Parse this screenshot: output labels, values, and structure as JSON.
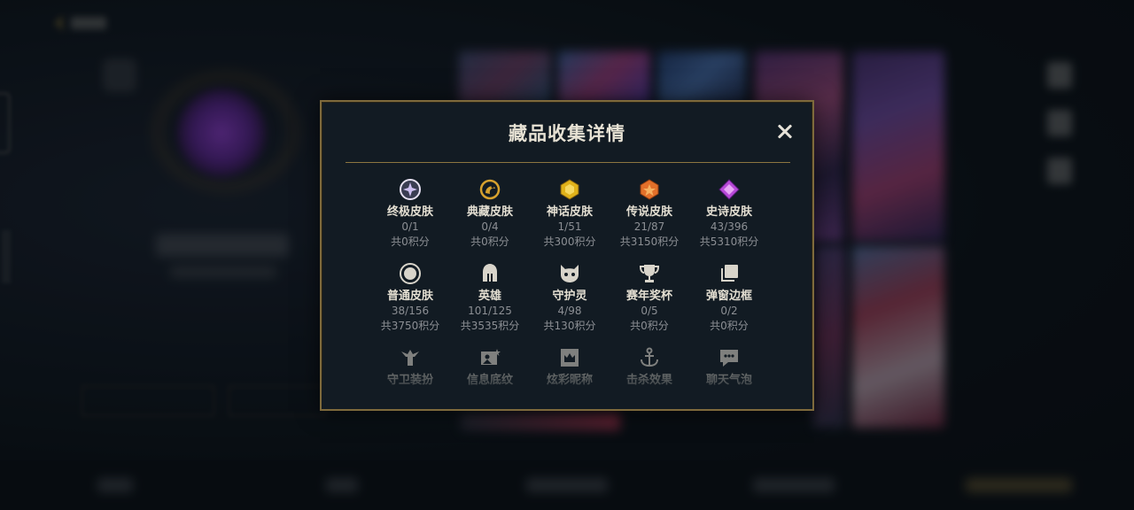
{
  "modal": {
    "title": "藏品收集详情",
    "close_icon": "close-icon",
    "categories": [
      {
        "label": "终极皮肤",
        "count": "0/1",
        "points": "共0积分",
        "icon": "ultimate-skin-icon",
        "color": "#c9b8e8"
      },
      {
        "label": "典藏皮肤",
        "count": "0/4",
        "points": "共0积分",
        "icon": "prestige-skin-icon",
        "color": "#d6a12e"
      },
      {
        "label": "神话皮肤",
        "count": "1/51",
        "points": "共300积分",
        "icon": "mythic-skin-icon",
        "color": "#e0b21a"
      },
      {
        "label": "传说皮肤",
        "count": "21/87",
        "points": "共3150积分",
        "icon": "legendary-skin-icon",
        "color": "#e2702a"
      },
      {
        "label": "史诗皮肤",
        "count": "43/396",
        "points": "共5310积分",
        "icon": "epic-skin-icon",
        "color": "#b84ad8"
      },
      {
        "label": "普通皮肤",
        "count": "38/156",
        "points": "共3750积分",
        "icon": "common-skin-icon",
        "color": "#d8d4ca"
      },
      {
        "label": "英雄",
        "count": "101/125",
        "points": "共3535积分",
        "icon": "champion-helmet-icon",
        "color": "#d8d4ca"
      },
      {
        "label": "守护灵",
        "count": "4/98",
        "points": "共130积分",
        "icon": "guardian-spirit-icon",
        "color": "#d8d4ca"
      },
      {
        "label": "赛年奖杯",
        "count": "0/5",
        "points": "共0积分",
        "icon": "trophy-icon",
        "color": "#d8d4ca"
      },
      {
        "label": "弹窗边框",
        "count": "0/2",
        "points": "共0积分",
        "icon": "popup-frame-icon",
        "color": "#d8d4ca"
      },
      {
        "label": "守卫装扮",
        "icon": "ward-skin-icon",
        "color": "#d8d4ca"
      },
      {
        "label": "信息底纹",
        "icon": "profile-banner-icon",
        "color": "#d8d4ca"
      },
      {
        "label": "炫彩昵称",
        "icon": "chroma-name-icon",
        "color": "#d8d4ca"
      },
      {
        "label": "击杀效果",
        "icon": "kill-effect-icon",
        "color": "#d8d4ca"
      },
      {
        "label": "聊天气泡",
        "icon": "chat-bubble-icon",
        "color": "#d8d4ca"
      }
    ]
  },
  "colors": {
    "modal_border": "#7e6a3c",
    "modal_bg": "#121b23",
    "title": "#e7e2d4",
    "muted_text": "#8c8f94"
  }
}
